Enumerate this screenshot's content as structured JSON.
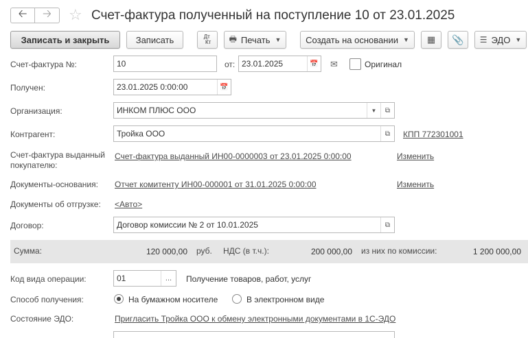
{
  "window": {
    "title": "Счет-фактура полученный на поступление 10 от 23.01.2025"
  },
  "toolbar": {
    "save_close": "Записать и закрыть",
    "save": "Записать",
    "dtkt": "Дт Кт",
    "print": "Печать",
    "create_based": "Создать на основании",
    "edo": "ЭДО"
  },
  "form": {
    "invoice_no_label": "Счет-фактура №:",
    "invoice_no_value": "10",
    "from_label": "от:",
    "from_value": "23.01.2025",
    "original_label": "Оригинал",
    "received_label": "Получен:",
    "received_value": "23.01.2025  0:00:00",
    "org_label": "Организация:",
    "org_value": "ИНКОМ ПЛЮС ООО",
    "counterparty_label": "Контрагент:",
    "counterparty_value": "Тройка ООО",
    "kpp_link": "КПП 772301001",
    "issued_invoice_label_1": "Счет-фактура выданный",
    "issued_invoice_label_2": "покупателю:",
    "issued_invoice_link": "Счет-фактура выданный ИН00-0000003 от 23.01.2025 0:00:00",
    "change_1": "Изменить",
    "base_docs_label": "Документы-основания:",
    "base_docs_link": "Отчет комитенту ИН00-000001 от 31.01.2025 0:00:00",
    "change_2": "Изменить",
    "shipment_docs_label": "Документы об отгрузке:",
    "shipment_docs_link": "<Авто>",
    "contract_label": "Договор:",
    "contract_value": "Договор комиссии № 2 от 10.01.2025"
  },
  "sums": {
    "sum_label": "Сумма:",
    "sum_value": "120 000,00",
    "currency": "руб.",
    "vat_label": "НДС (в т.ч.):",
    "vat_value": "200 000,00",
    "commission_label": "из них по комиссии:",
    "commission_value": "1 200 000,00"
  },
  "bottom": {
    "op_code_label": "Код вида операции:",
    "op_code_value": "01",
    "op_code_btn": "...",
    "op_code_desc": "Получение товаров, работ, услуг",
    "method_label": "Способ получения:",
    "method_paper": "На бумажном носителе",
    "method_electronic": "В электронном виде",
    "edo_state_label": "Состояние ЭДО:",
    "edo_state_link": "Пригласить Тройка ООО к обмену электронными документами в 1С-ЭДО"
  }
}
